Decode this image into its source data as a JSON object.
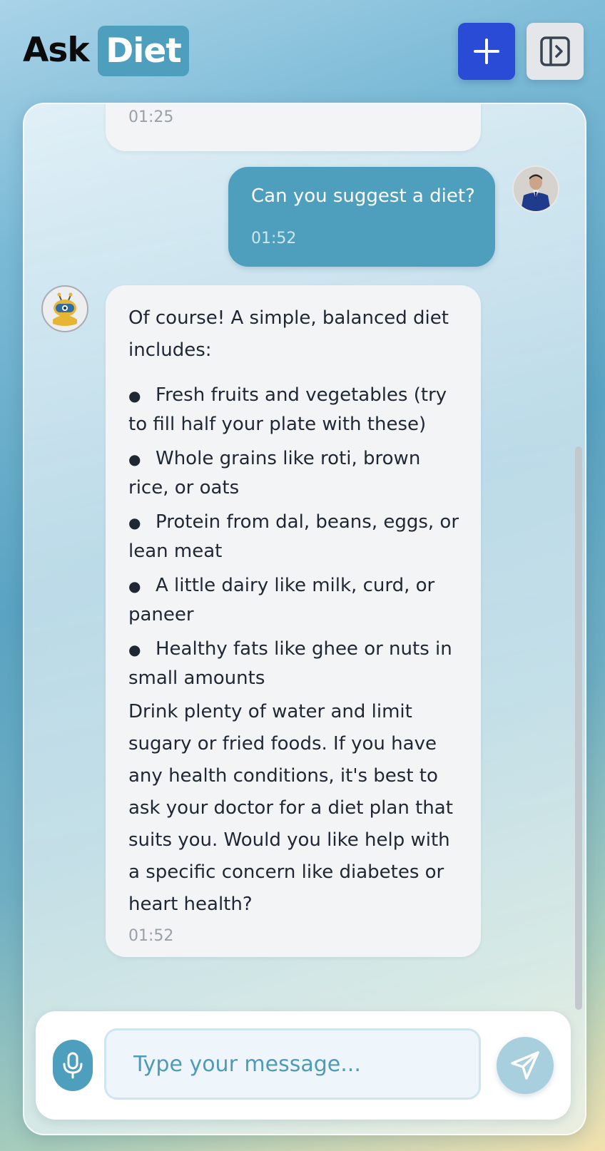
{
  "header": {
    "brand_part1": "Ask",
    "brand_part2": "Diet",
    "new_chat_icon": "plus-icon",
    "sidebar_toggle_icon": "panel-right-open-icon"
  },
  "messages": [
    {
      "role": "assistant",
      "time": "01:25"
    },
    {
      "role": "user",
      "text": "Can you suggest a diet?",
      "time": "01:52"
    },
    {
      "role": "assistant",
      "intro": "Of course! A simple, balanced diet includes:",
      "items": [
        "Fresh fruits and vegetables (try to fill half your plate with these)",
        "Whole grains like roti, brown rice, or oats",
        "Protein from dal, beans, eggs, or lean meat",
        "A little dairy like milk, curd, or paneer",
        "Healthy fats like ghee or nuts in small amounts"
      ],
      "outro": "Drink plenty of water and limit sugary or fried foods. If you have any health conditions, it's best to ask your doctor for a diet plan that suits you. Would you like help with a specific concern like diabetes or heart health?",
      "time": "01:52"
    }
  ],
  "composer": {
    "placeholder": "Type your message...",
    "mic_icon": "microphone-icon",
    "send_icon": "send-icon"
  },
  "colors": {
    "brand_accent": "#4d9fbd",
    "new_chat_button": "#2a4bd6",
    "user_bubble": "#4e9fbd",
    "bot_bubble": "#f2f4f6"
  }
}
